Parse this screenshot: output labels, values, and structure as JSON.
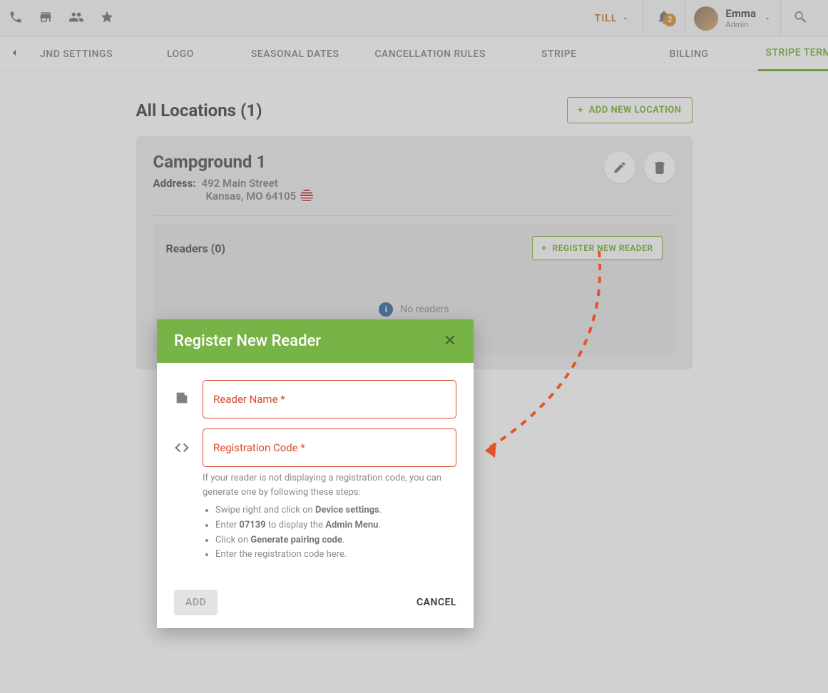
{
  "topbar": {
    "till_label": "TILL",
    "notification_count": "2",
    "user_name": "Emma",
    "user_role": "Admin"
  },
  "tabs": {
    "jnd": "JND SETTINGS",
    "logo": "LOGO",
    "seasonal": "SEASONAL DATES",
    "cancellation": "CANCELLATION RULES",
    "stripe": "STRIPE",
    "billing": "BILLING",
    "terminal": "STRIPE TERMINAL"
  },
  "page": {
    "heading": "All Locations (1)",
    "add_location": "ADD NEW LOCATION"
  },
  "location": {
    "name": "Campground 1",
    "address_label": "Address:",
    "street": "492 Main Street",
    "city_line": "Kansas, MO 64105",
    "readers_heading": "Readers (0)",
    "register_reader": "REGISTER NEW READER",
    "no_readers": "No readers"
  },
  "modal": {
    "title": "Register New Reader",
    "reader_name_label": "Reader Name *",
    "reg_code_label": "Registration Code *",
    "help_text": "If your reader is not displaying a registration code, you can generate one by following these steps:",
    "step1_a": "Swipe right and click on ",
    "step1_b": "Device settings",
    "step1_c": ".",
    "step2_a": "Enter ",
    "step2_b": "07139",
    "step2_c": " to display the ",
    "step2_d": "Admin Menu",
    "step2_e": ".",
    "step3_a": "Click on ",
    "step3_b": "Generate pairing code",
    "step3_c": ".",
    "step4": "Enter the registration code here.",
    "add_btn": "ADD",
    "cancel_btn": "CANCEL"
  }
}
